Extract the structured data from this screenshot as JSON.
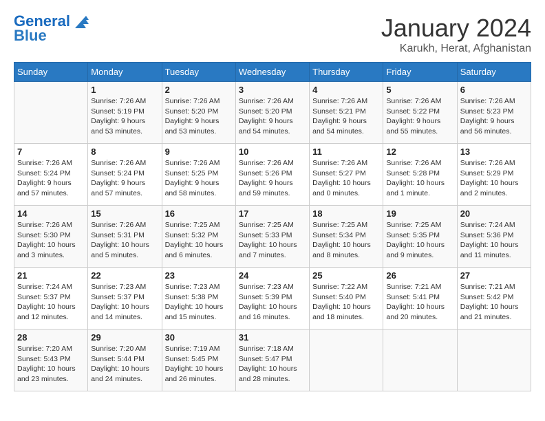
{
  "header": {
    "logo_line1": "General",
    "logo_line2": "Blue",
    "month_title": "January 2024",
    "location": "Karukh, Herat, Afghanistan"
  },
  "days_of_week": [
    "Sunday",
    "Monday",
    "Tuesday",
    "Wednesday",
    "Thursday",
    "Friday",
    "Saturday"
  ],
  "weeks": [
    [
      {
        "day": "",
        "info": ""
      },
      {
        "day": "1",
        "info": "Sunrise: 7:26 AM\nSunset: 5:19 PM\nDaylight: 9 hours\nand 53 minutes."
      },
      {
        "day": "2",
        "info": "Sunrise: 7:26 AM\nSunset: 5:20 PM\nDaylight: 9 hours\nand 53 minutes."
      },
      {
        "day": "3",
        "info": "Sunrise: 7:26 AM\nSunset: 5:20 PM\nDaylight: 9 hours\nand 54 minutes."
      },
      {
        "day": "4",
        "info": "Sunrise: 7:26 AM\nSunset: 5:21 PM\nDaylight: 9 hours\nand 54 minutes."
      },
      {
        "day": "5",
        "info": "Sunrise: 7:26 AM\nSunset: 5:22 PM\nDaylight: 9 hours\nand 55 minutes."
      },
      {
        "day": "6",
        "info": "Sunrise: 7:26 AM\nSunset: 5:23 PM\nDaylight: 9 hours\nand 56 minutes."
      }
    ],
    [
      {
        "day": "7",
        "info": "Sunrise: 7:26 AM\nSunset: 5:24 PM\nDaylight: 9 hours\nand 57 minutes."
      },
      {
        "day": "8",
        "info": "Sunrise: 7:26 AM\nSunset: 5:24 PM\nDaylight: 9 hours\nand 57 minutes."
      },
      {
        "day": "9",
        "info": "Sunrise: 7:26 AM\nSunset: 5:25 PM\nDaylight: 9 hours\nand 58 minutes."
      },
      {
        "day": "10",
        "info": "Sunrise: 7:26 AM\nSunset: 5:26 PM\nDaylight: 9 hours\nand 59 minutes."
      },
      {
        "day": "11",
        "info": "Sunrise: 7:26 AM\nSunset: 5:27 PM\nDaylight: 10 hours\nand 0 minutes."
      },
      {
        "day": "12",
        "info": "Sunrise: 7:26 AM\nSunset: 5:28 PM\nDaylight: 10 hours\nand 1 minute."
      },
      {
        "day": "13",
        "info": "Sunrise: 7:26 AM\nSunset: 5:29 PM\nDaylight: 10 hours\nand 2 minutes."
      }
    ],
    [
      {
        "day": "14",
        "info": "Sunrise: 7:26 AM\nSunset: 5:30 PM\nDaylight: 10 hours\nand 3 minutes."
      },
      {
        "day": "15",
        "info": "Sunrise: 7:26 AM\nSunset: 5:31 PM\nDaylight: 10 hours\nand 5 minutes."
      },
      {
        "day": "16",
        "info": "Sunrise: 7:25 AM\nSunset: 5:32 PM\nDaylight: 10 hours\nand 6 minutes."
      },
      {
        "day": "17",
        "info": "Sunrise: 7:25 AM\nSunset: 5:33 PM\nDaylight: 10 hours\nand 7 minutes."
      },
      {
        "day": "18",
        "info": "Sunrise: 7:25 AM\nSunset: 5:34 PM\nDaylight: 10 hours\nand 8 minutes."
      },
      {
        "day": "19",
        "info": "Sunrise: 7:25 AM\nSunset: 5:35 PM\nDaylight: 10 hours\nand 9 minutes."
      },
      {
        "day": "20",
        "info": "Sunrise: 7:24 AM\nSunset: 5:36 PM\nDaylight: 10 hours\nand 11 minutes."
      }
    ],
    [
      {
        "day": "21",
        "info": "Sunrise: 7:24 AM\nSunset: 5:37 PM\nDaylight: 10 hours\nand 12 minutes."
      },
      {
        "day": "22",
        "info": "Sunrise: 7:23 AM\nSunset: 5:37 PM\nDaylight: 10 hours\nand 14 minutes."
      },
      {
        "day": "23",
        "info": "Sunrise: 7:23 AM\nSunset: 5:38 PM\nDaylight: 10 hours\nand 15 minutes."
      },
      {
        "day": "24",
        "info": "Sunrise: 7:23 AM\nSunset: 5:39 PM\nDaylight: 10 hours\nand 16 minutes."
      },
      {
        "day": "25",
        "info": "Sunrise: 7:22 AM\nSunset: 5:40 PM\nDaylight: 10 hours\nand 18 minutes."
      },
      {
        "day": "26",
        "info": "Sunrise: 7:21 AM\nSunset: 5:41 PM\nDaylight: 10 hours\nand 20 minutes."
      },
      {
        "day": "27",
        "info": "Sunrise: 7:21 AM\nSunset: 5:42 PM\nDaylight: 10 hours\nand 21 minutes."
      }
    ],
    [
      {
        "day": "28",
        "info": "Sunrise: 7:20 AM\nSunset: 5:43 PM\nDaylight: 10 hours\nand 23 minutes."
      },
      {
        "day": "29",
        "info": "Sunrise: 7:20 AM\nSunset: 5:44 PM\nDaylight: 10 hours\nand 24 minutes."
      },
      {
        "day": "30",
        "info": "Sunrise: 7:19 AM\nSunset: 5:45 PM\nDaylight: 10 hours\nand 26 minutes."
      },
      {
        "day": "31",
        "info": "Sunrise: 7:18 AM\nSunset: 5:47 PM\nDaylight: 10 hours\nand 28 minutes."
      },
      {
        "day": "",
        "info": ""
      },
      {
        "day": "",
        "info": ""
      },
      {
        "day": "",
        "info": ""
      }
    ]
  ]
}
